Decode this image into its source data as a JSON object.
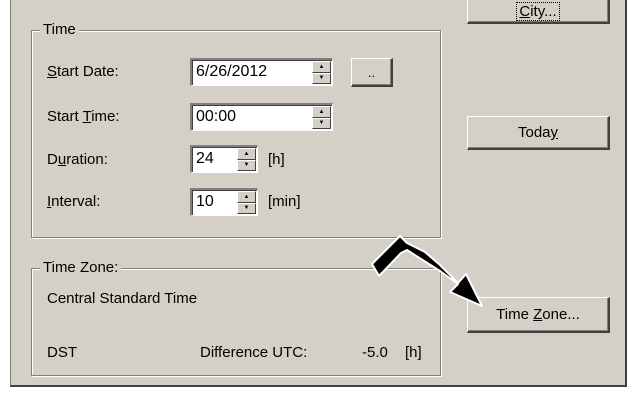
{
  "time_group": {
    "title": "Time",
    "start_date": {
      "label_u": "S",
      "label_rest": "tart Date:",
      "value": "6/26/2012",
      "picker_label": ".."
    },
    "start_time": {
      "label_pre": "Start ",
      "label_u": "T",
      "label_rest": "ime:",
      "value": "00:00"
    },
    "duration": {
      "label_pre": "D",
      "label_u": "u",
      "label_rest": "ration:",
      "value": "24",
      "unit": "[h]"
    },
    "interval": {
      "label_u": "I",
      "label_rest": "nterval:",
      "value": "10",
      "unit": "[min]"
    }
  },
  "timezone_group": {
    "title": "Time Zone:",
    "zone_name": "Central Standard Time",
    "dst_label": "DST",
    "diff_label": "Difference UTC:",
    "diff_value": "-5.0",
    "diff_unit": "[h]"
  },
  "buttons": {
    "city": {
      "pre": "",
      "u": "C",
      "rest": "ity..."
    },
    "today": {
      "pre": "Toda",
      "u": "y",
      "rest": ""
    },
    "timezone": {
      "pre": "Time ",
      "u": "Z",
      "rest": "one..."
    }
  },
  "colors": {
    "dialog_bg": "#d4d0c8",
    "arrow": "#000000"
  },
  "icons": {
    "annotation_arrow": "arrow-icon",
    "spin_up": "spin-up-icon",
    "spin_down": "spin-down-icon"
  }
}
